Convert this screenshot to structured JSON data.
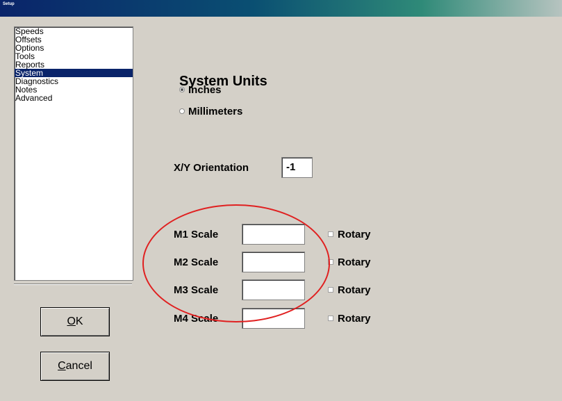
{
  "window": {
    "title": "Setup",
    "controls": ""
  },
  "sidebar": {
    "items": [
      {
        "label": "Speeds"
      },
      {
        "label": "Offsets"
      },
      {
        "label": "Options"
      },
      {
        "label": "Tools"
      },
      {
        "label": "Reports"
      },
      {
        "label": "System",
        "selected": true
      },
      {
        "label": "Diagnostics"
      },
      {
        "label": "Notes"
      },
      {
        "label": "Advanced"
      }
    ]
  },
  "buttons": {
    "ok_accel": "O",
    "ok_rest": "K",
    "cancel_accel": "C",
    "cancel_rest": "ancel"
  },
  "system_units": {
    "heading": "System Units",
    "options": [
      {
        "label": "Inches",
        "selected": true
      },
      {
        "label": "Millimeters",
        "selected": false
      }
    ]
  },
  "orientation": {
    "label": "X/Y Orientation",
    "value": "-1"
  },
  "scales": [
    {
      "label": "M1 Scale",
      "value": "",
      "rotary_label": "Rotary",
      "rotary_checked": false
    },
    {
      "label": "M2 Scale",
      "value": "",
      "rotary_label": "Rotary",
      "rotary_checked": false
    },
    {
      "label": "M3 Scale",
      "value": "",
      "rotary_label": "Rotary",
      "rotary_checked": false
    },
    {
      "label": "M4 Scale",
      "value": "",
      "rotary_label": "Rotary",
      "rotary_checked": false
    }
  ],
  "annotation_color": "#e02020"
}
